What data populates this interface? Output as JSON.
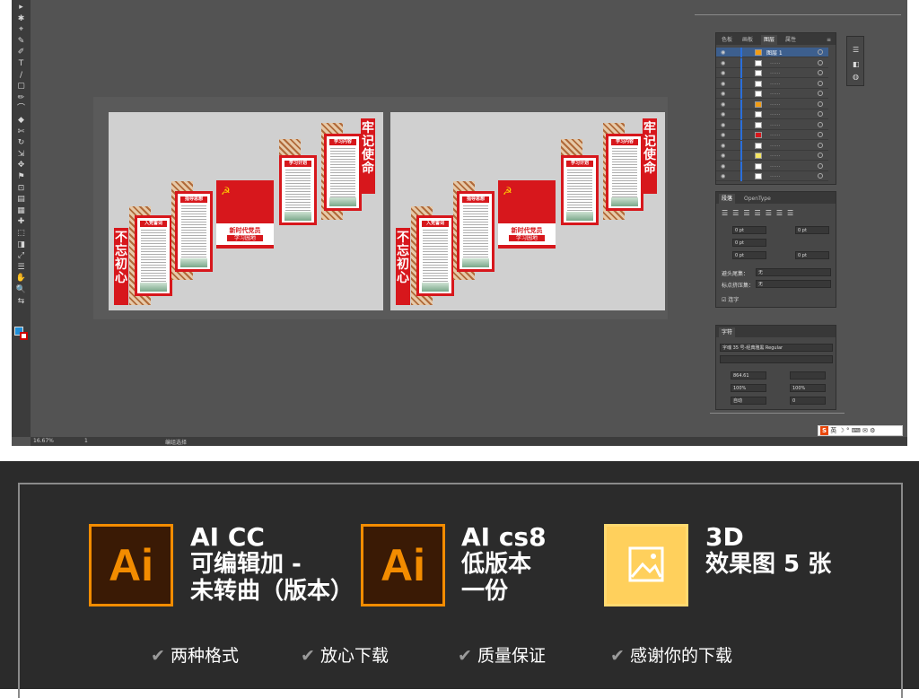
{
  "toolbar": {
    "tool_glyphs": [
      "▸",
      "✱",
      "⌖",
      "✎",
      "✐",
      "T",
      "/",
      "▢",
      "✏",
      "⌒",
      "◆",
      "✄",
      "↻",
      "⇲",
      "✥",
      "⚑",
      "⊡",
      "▤",
      "▦",
      "✚",
      "⬚",
      "◨",
      "⤢",
      "☰",
      "✋",
      "🔍",
      "⇆"
    ]
  },
  "artboards": [
    {
      "banner_left": "不忘初心",
      "banner_right": "牢记使命",
      "panel_1_title": "入党誓词",
      "panel_2_title": "指导思想",
      "panel_3_title": "学习计划",
      "panel_4_title": "学习内容",
      "slogan_title": "新时代党员",
      "slogan_sub": "学习园地",
      "emblem": "☭"
    },
    {
      "banner_left": "不忘初心",
      "banner_right": "牢记使命",
      "panel_1_title": "入党誓词",
      "panel_2_title": "指导思想",
      "panel_3_title": "学习计划",
      "panel_4_title": "学习内容",
      "slogan_title": "新时代党员",
      "slogan_sub": "学习园地",
      "emblem": "☭"
    }
  ],
  "layers_panel": {
    "tabs": [
      "色板",
      "画板",
      "图层",
      "属性"
    ],
    "active_tab": "图层",
    "top_layer_name": "图层 1",
    "row_marker": "......"
  },
  "paragraph_panel": {
    "tabs": [
      "段落",
      "OpenType"
    ],
    "indent_values": [
      "0 pt",
      "0 pt",
      "0 pt",
      "0 pt"
    ],
    "label_kinsoku": "避头尾集：",
    "value_kinsoku": "无",
    "label_mojikumi": "标点挤压集：",
    "value_mojikumi": "无",
    "hyphenate_label": "连字"
  },
  "character_panel": {
    "tab": "字符",
    "font_name": "字魂 35 号-经典雅黑 Regular",
    "font_style": "",
    "size": "864.61",
    "scale_v": "100%",
    "scale_h": "100%",
    "leading": "自动",
    "tracking": "0"
  },
  "statusbar": {
    "zoom": "16.67%",
    "artboard_num": "1",
    "status_text": "编组选择"
  },
  "ime": {
    "text": "英 ☽ ° ⌨ ✉ ⚙"
  },
  "promo": {
    "item1_logo": "Ai",
    "item1_line1": "AI CC",
    "item1_line2": "可编辑加 -",
    "item1_line3": "未转曲（版本）",
    "item2_logo": "Ai",
    "item2_line1": "AI cs8",
    "item2_line2": "低版本",
    "item2_line3": "一份",
    "item3_line1": "3D",
    "item3_line2": "效果图 5 张",
    "checks": [
      "两种格式",
      "放心下载",
      "质量保证",
      "感谢你的下载"
    ]
  },
  "colors": {
    "accent_red": "#d7171c",
    "ai_orange": "#f38c00",
    "ai_bg": "#3a1a05",
    "image_yellow": "#ffd05c"
  }
}
